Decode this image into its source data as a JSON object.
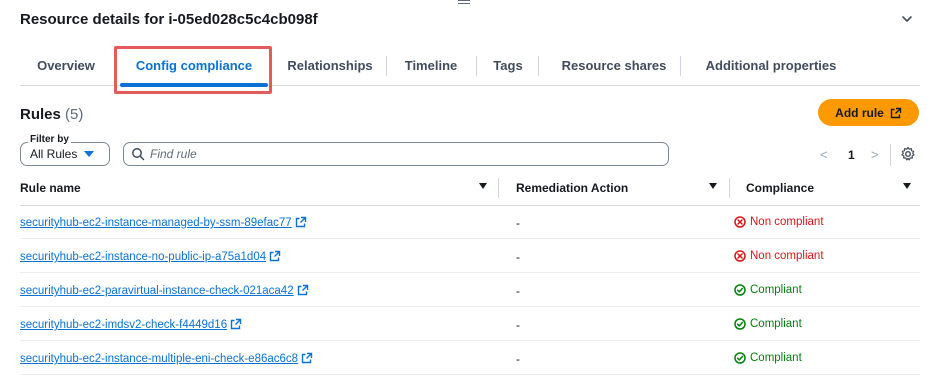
{
  "page": {
    "title": "Resource details for i-05ed028c5c4cb098f"
  },
  "tabs": [
    {
      "label": "Overview"
    },
    {
      "label": "Config compliance"
    },
    {
      "label": "Relationships"
    },
    {
      "label": "Timeline"
    },
    {
      "label": "Tags"
    },
    {
      "label": "Resource shares"
    },
    {
      "label": "Additional properties"
    }
  ],
  "rules": {
    "heading": "Rules",
    "count": "(5)",
    "add_rule_label": "Add rule"
  },
  "filter": {
    "legend": "Filter by",
    "value": "All Rules"
  },
  "search": {
    "placeholder": "Find rule"
  },
  "pagination": {
    "prev": "<",
    "page": "1",
    "next": ">"
  },
  "table": {
    "columns": [
      "Rule name",
      "Remediation Action",
      "Compliance"
    ],
    "rows": [
      {
        "name": "securityhub-ec2-instance-managed-by-ssm-89efac77",
        "remediation": "-",
        "compliance": "Non compliant",
        "status": "bad"
      },
      {
        "name": "securityhub-ec2-instance-no-public-ip-a75a1d04",
        "remediation": "-",
        "compliance": "Non compliant",
        "status": "bad"
      },
      {
        "name": "securityhub-ec2-paravirtual-instance-check-021aca42",
        "remediation": "-",
        "compliance": "Compliant",
        "status": "good"
      },
      {
        "name": "securityhub-ec2-imdsv2-check-f4449d16",
        "remediation": "-",
        "compliance": "Compliant",
        "status": "good"
      },
      {
        "name": "securityhub-ec2-instance-multiple-eni-check-e86ac6c8",
        "remediation": "-",
        "compliance": "Compliant",
        "status": "good"
      }
    ]
  },
  "colors": {
    "link": "#0972d3",
    "primary_button": "#ff9900",
    "non_compliant": "#d91515",
    "compliant": "#037f0c",
    "highlight": "#e35b5b"
  }
}
